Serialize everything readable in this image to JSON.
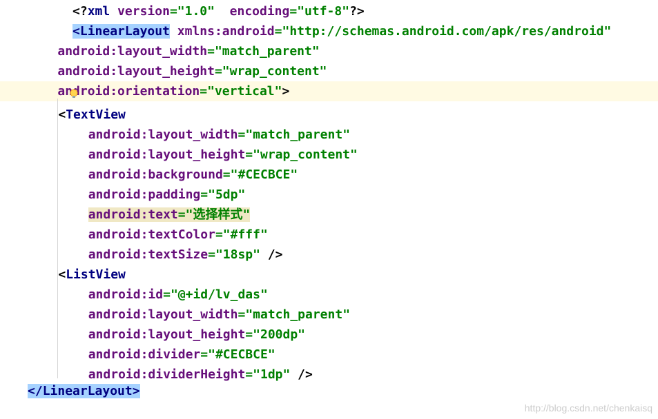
{
  "xml": {
    "declaration": {
      "open": "<?",
      "xml": "xml",
      "version_attr": "version",
      "version_val": "\"1.0\"",
      "encoding_attr": "encoding",
      "encoding_val": "\"utf-8\"",
      "close": "?>"
    },
    "linearLayout": {
      "open": "<",
      "tag": "LinearLayout",
      "xmlns_attr": "xmlns:android",
      "xmlns_val": "\"http://schemas.android.com/apk/res/android\"",
      "width_attr": "android:layout_width",
      "width_val": "\"match_parent\"",
      "height_attr": "android:layout_height",
      "height_val": "\"wrap_content\"",
      "orient_attr": "android:orientation",
      "orient_val": "\"vertical\"",
      "close_open": "</",
      "close_tag": "LinearLayout",
      "close_end": ">"
    },
    "textView": {
      "open": "<",
      "tag": "TextView",
      "width_attr": "android:layout_width",
      "width_val": "\"match_parent\"",
      "height_attr": "android:layout_height",
      "height_val": "\"wrap_content\"",
      "bg_attr": "android:background",
      "bg_val": "\"#CECBCE\"",
      "padding_attr": "android:padding",
      "padding_val": "\"5dp\"",
      "text_attr": "android:text",
      "text_val": "\"选择样式\"",
      "color_attr": "android:textColor",
      "color_val": "\"#fff\"",
      "size_attr": "android:textSize",
      "size_val": "\"18sp\"",
      "selfclose": " />"
    },
    "listView": {
      "open": "<",
      "tag": "ListView",
      "id_attr": "android:id",
      "id_val": "\"@+id/lv_das\"",
      "width_attr": "android:layout_width",
      "width_val": "\"match_parent\"",
      "height_attr": "android:layout_height",
      "height_val": "\"200dp\"",
      "divider_attr": "android:divider",
      "divider_val": "\"#CECBCE\"",
      "divheight_attr": "android:dividerHeight",
      "divheight_val": "\"1dp\"",
      "selfclose": " />"
    },
    "eq": "=",
    "gt": ">",
    "space": " "
  },
  "watermark": "http://blog.csdn.net/chenkaisq"
}
